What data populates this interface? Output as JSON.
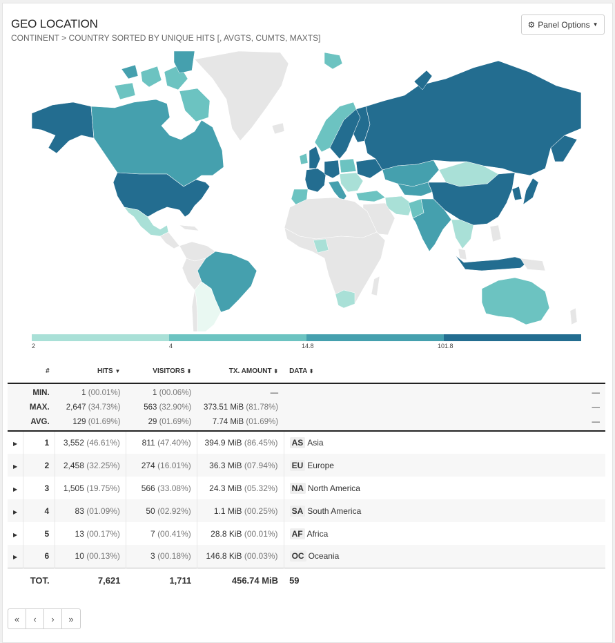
{
  "header": {
    "title": "GEO LOCATION",
    "subtitle": "CONTINENT > COUNTRY SORTED BY UNIQUE HITS [, AVGTS, CUMTS, MAXTS]",
    "options_label": "Panel Options"
  },
  "legend": {
    "labels": [
      "2",
      "4",
      "14.8",
      "101.8"
    ],
    "colors": [
      "#a9e0d7",
      "#6cc3c1",
      "#45a0ae",
      "#236d90"
    ]
  },
  "colors": {
    "nodata": "#e6e6e6",
    "lightest": "#e9f8f2",
    "light": "#a9e0d7",
    "mid": "#6cc3c1",
    "midDark": "#45a0ae",
    "dark": "#236d90"
  },
  "table": {
    "headers": {
      "index": "#",
      "hits": "HITS",
      "visitors": "VISITORS",
      "tx": "TX. AMOUNT",
      "data": "DATA"
    },
    "meta": [
      {
        "label": "MIN.",
        "hits": "1",
        "hits_pct": "(00.01%)",
        "visitors": "1",
        "visitors_pct": "(00.06%)",
        "tx": "—",
        "tx_pct": "",
        "data": "—"
      },
      {
        "label": "MAX.",
        "hits": "2,647",
        "hits_pct": "(34.73%)",
        "visitors": "563",
        "visitors_pct": "(32.90%)",
        "tx": "373.51 MiB",
        "tx_pct": "(81.78%)",
        "data": "—"
      },
      {
        "label": "AVG.",
        "hits": "129",
        "hits_pct": "(01.69%)",
        "visitors": "29",
        "visitors_pct": "(01.69%)",
        "tx": "7.74 MiB",
        "tx_pct": "(01.69%)",
        "data": "—"
      }
    ],
    "rows": [
      {
        "idx": "1",
        "hits": "3,552",
        "hits_pct": "(46.61%)",
        "visitors": "811",
        "visitors_pct": "(47.40%)",
        "tx": "394.9 MiB",
        "tx_pct": "(86.45%)",
        "code": "AS",
        "name": "Asia"
      },
      {
        "idx": "2",
        "hits": "2,458",
        "hits_pct": "(32.25%)",
        "visitors": "274",
        "visitors_pct": "(16.01%)",
        "tx": "36.3 MiB",
        "tx_pct": "(07.94%)",
        "code": "EU",
        "name": "Europe"
      },
      {
        "idx": "3",
        "hits": "1,505",
        "hits_pct": "(19.75%)",
        "visitors": "566",
        "visitors_pct": "(33.08%)",
        "tx": "24.3 MiB",
        "tx_pct": "(05.32%)",
        "code": "NA",
        "name": "North America"
      },
      {
        "idx": "4",
        "hits": "83",
        "hits_pct": "(01.09%)",
        "visitors": "50",
        "visitors_pct": "(02.92%)",
        "tx": "1.1 MiB",
        "tx_pct": "(00.25%)",
        "code": "SA",
        "name": "South America"
      },
      {
        "idx": "5",
        "hits": "13",
        "hits_pct": "(00.17%)",
        "visitors": "7",
        "visitors_pct": "(00.41%)",
        "tx": "28.8 KiB",
        "tx_pct": "(00.01%)",
        "code": "AF",
        "name": "Africa"
      },
      {
        "idx": "6",
        "hits": "10",
        "hits_pct": "(00.13%)",
        "visitors": "3",
        "visitors_pct": "(00.18%)",
        "tx": "146.8 KiB",
        "tx_pct": "(00.03%)",
        "code": "OC",
        "name": "Oceania"
      }
    ],
    "totals": {
      "label": "TOT.",
      "hits": "7,621",
      "visitors": "1,711",
      "tx": "456.74 MiB",
      "data": "59"
    }
  },
  "pager": {
    "first": "«",
    "prev": "‹",
    "next": "›",
    "last": "»"
  }
}
